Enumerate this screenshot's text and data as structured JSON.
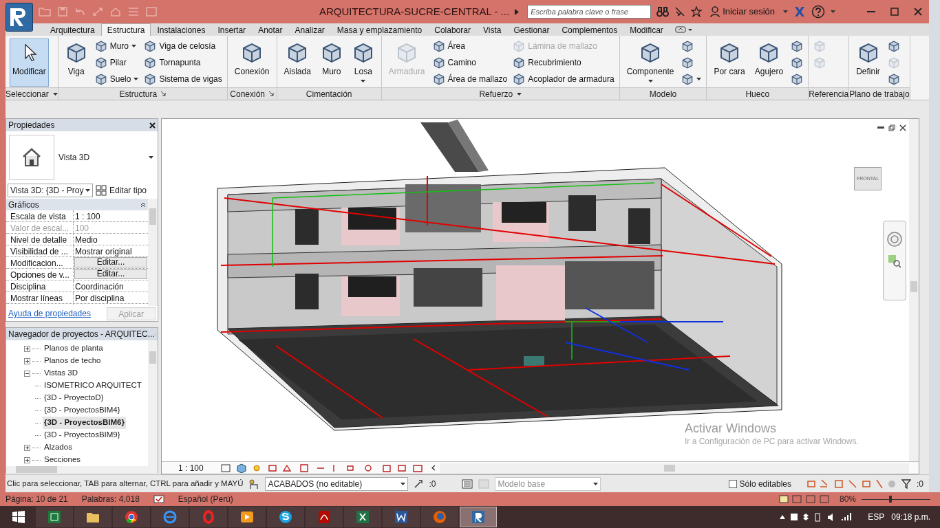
{
  "title_bar": {
    "title": "ARQUITECTURA-SUCRE-CENTRAL - ...",
    "search_placeholder": "Escriba palabra clave o frase",
    "sign_in": "Iniciar sesión"
  },
  "ribbon_tabs": [
    {
      "label": "Arquitectura",
      "selected": false
    },
    {
      "label": "Estructura",
      "selected": true
    },
    {
      "label": "Instalaciones",
      "selected": false
    },
    {
      "label": "Insertar",
      "selected": false
    },
    {
      "label": "Anotar",
      "selected": false
    },
    {
      "label": "Analizar",
      "selected": false
    },
    {
      "label": "Masa y emplazamiento",
      "selected": false
    },
    {
      "label": "Colaborar",
      "selected": false
    },
    {
      "label": "Vista",
      "selected": false
    },
    {
      "label": "Gestionar",
      "selected": false
    },
    {
      "label": "Complementos",
      "selected": false
    },
    {
      "label": "Modificar",
      "selected": false
    }
  ],
  "ribbon_panels": [
    {
      "title": "Seleccionar",
      "has_dropdown": true,
      "has_launcher": false,
      "groups": [
        {
          "kind": "large",
          "label": "Modificar",
          "selected": true,
          "disabled": false,
          "has_menu": false
        }
      ]
    },
    {
      "title": "Estructura",
      "has_dropdown": false,
      "has_launcher": true,
      "groups": [
        {
          "kind": "large",
          "label": "Viga",
          "selected": false,
          "disabled": false,
          "has_menu": false
        },
        {
          "kind": "stack",
          "items": [
            {
              "label": "Muro",
              "disabled": false,
              "has_menu": true
            },
            {
              "label": "Pilar",
              "disabled": false,
              "has_menu": false
            },
            {
              "label": "Suelo",
              "disabled": false,
              "has_menu": true
            }
          ]
        },
        {
          "kind": "stack",
          "items": [
            {
              "label": "Viga de celosía",
              "disabled": false,
              "has_menu": false
            },
            {
              "label": "Tornapunta",
              "disabled": false,
              "has_menu": false
            },
            {
              "label": "Sistema de vigas",
              "disabled": false,
              "has_menu": false
            }
          ]
        }
      ]
    },
    {
      "title": "Conexión",
      "has_dropdown": false,
      "has_launcher": true,
      "groups": [
        {
          "kind": "large",
          "label": "Conexión",
          "selected": false,
          "disabled": false,
          "has_menu": false
        }
      ]
    },
    {
      "title": "Cimentación",
      "has_dropdown": false,
      "has_launcher": false,
      "groups": [
        {
          "kind": "large",
          "label": "Aislada",
          "selected": false,
          "disabled": false,
          "has_menu": false
        },
        {
          "kind": "large",
          "label": "Muro",
          "selected": false,
          "disabled": false,
          "has_menu": false
        },
        {
          "kind": "large",
          "label": "Losa",
          "selected": false,
          "disabled": false,
          "has_menu": true
        }
      ]
    },
    {
      "title": "Refuerzo",
      "has_dropdown": true,
      "has_launcher": false,
      "groups": [
        {
          "kind": "large",
          "label": "Armadura",
          "selected": false,
          "disabled": true,
          "has_menu": false
        },
        {
          "kind": "stack",
          "items": [
            {
              "label": "Área",
              "disabled": false,
              "has_menu": false
            },
            {
              "label": "Camino",
              "disabled": false,
              "has_menu": false
            },
            {
              "label": "Área de mallazo",
              "disabled": false,
              "has_menu": false
            }
          ]
        },
        {
          "kind": "stack",
          "items": [
            {
              "label": "Lámina de mallazo",
              "disabled": true,
              "has_menu": false
            },
            {
              "label": "Recubrimiento",
              "disabled": false,
              "has_menu": false
            },
            {
              "label": "Acoplador de armadura",
              "disabled": false,
              "has_menu": false
            }
          ]
        }
      ]
    },
    {
      "title": "Modelo",
      "has_dropdown": false,
      "has_launcher": false,
      "groups": [
        {
          "kind": "large",
          "label": "Componente",
          "selected": false,
          "disabled": false,
          "has_menu": true
        },
        {
          "kind": "stack",
          "items": [
            {
              "disabled": false,
              "has_menu": false
            },
            {
              "disabled": false,
              "has_menu": false
            },
            {
              "disabled": false,
              "has_menu": true
            }
          ]
        }
      ]
    },
    {
      "title": "Hueco",
      "has_dropdown": false,
      "has_launcher": false,
      "groups": [
        {
          "kind": "large",
          "label": "Por cara",
          "selected": false,
          "disabled": false,
          "has_menu": false
        },
        {
          "kind": "large",
          "label": "Agujero",
          "selected": false,
          "disabled": false,
          "has_menu": false
        },
        {
          "kind": "stack",
          "items": [
            {
              "disabled": false,
              "has_menu": false
            },
            {
              "disabled": false,
              "has_menu": false
            },
            {
              "disabled": false,
              "has_menu": false
            }
          ]
        }
      ]
    },
    {
      "title": "Referencia",
      "has_dropdown": false,
      "has_launcher": false,
      "groups": [
        {
          "kind": "stack",
          "items": [
            {
              "disabled": true,
              "has_menu": false
            },
            {
              "disabled": true,
              "has_menu": false
            }
          ]
        }
      ]
    },
    {
      "title": "Plano de trabajo",
      "has_dropdown": false,
      "has_launcher": false,
      "groups": [
        {
          "kind": "large",
          "label": "Definir",
          "selected": false,
          "disabled": false,
          "has_menu": false
        },
        {
          "kind": "stack",
          "items": [
            {
              "disabled": false,
              "has_menu": false
            },
            {
              "disabled": true,
              "has_menu": false
            },
            {
              "disabled": false,
              "has_menu": false
            }
          ]
        }
      ]
    }
  ],
  "properties": {
    "title": "Propiedades",
    "type_name": "Vista 3D",
    "selector": "Vista 3D: {3D - Proy",
    "edit_type": "Editar tipo",
    "section": "Gráficos",
    "rows": [
      {
        "name": "Escala de vista",
        "value": "1 : 100",
        "kind": "text",
        "disabled": false
      },
      {
        "name": "Valor de escal...",
        "value": "100",
        "kind": "text",
        "disabled": true
      },
      {
        "name": "Nivel de detalle",
        "value": "Medio",
        "kind": "text",
        "disabled": false
      },
      {
        "name": "Visibilidad de ...",
        "value": "Mostrar original",
        "kind": "text",
        "disabled": false
      },
      {
        "name": "Modificacion...",
        "value": "Editar...",
        "kind": "button",
        "disabled": false
      },
      {
        "name": "Opciones de v...",
        "value": "Editar...",
        "kind": "button",
        "disabled": false
      },
      {
        "name": "Disciplina",
        "value": "Coordinación",
        "kind": "text",
        "disabled": false
      },
      {
        "name": "Mostrar líneas",
        "value": "Por disciplina",
        "kind": "text",
        "disabled": false
      }
    ],
    "help_link": "Ayuda de propiedades",
    "apply": "Aplicar",
    "apply_disabled": true
  },
  "project_browser": {
    "title": "Navegador de proyectos - ARQUITEC...",
    "tree": [
      {
        "label": "Planos de planta",
        "expanded": false,
        "selected": false
      },
      {
        "label": "Planos de techo",
        "expanded": false,
        "selected": false
      },
      {
        "label": "Vistas 3D",
        "expanded": true,
        "selected": false,
        "children": [
          {
            "label": "ISOMETRICO ARQUITECT",
            "selected": false
          },
          {
            "label": "{3D - ProyectoD}",
            "selected": false
          },
          {
            "label": "{3D - ProyectosBIM4}",
            "selected": false
          },
          {
            "label": "{3D - ProyectosBIM6}",
            "selected": true
          },
          {
            "label": "{3D - ProyectosBIM9}",
            "selected": false
          }
        ]
      },
      {
        "label": "Alzados",
        "expanded": false,
        "selected": false
      },
      {
        "label": "Secciones",
        "expanded": false,
        "selected": false
      }
    ]
  },
  "viewport": {
    "view_cube_label": "FRONTAL",
    "scale": "1 : 100",
    "activation_title": "Activar Windows",
    "activation_text": "Ir a Configuración de PC para activar Windows."
  },
  "status_bar": {
    "hint": "Clic para seleccionar, TAB para alternar, CTRL para añadir y MAYÚ",
    "workset": "ACABADOS (no editable)",
    "workset_count": ":0",
    "design_option": "Modelo base",
    "editable_only": "Sólo editables",
    "editable_only_checked": false,
    "filter_count": ":0"
  },
  "word_status": {
    "page": "Página: 10 de 21",
    "words": "Palabras: 4,018",
    "language": "Español (Perú)",
    "zoom": "80%",
    "zoom_slider": {
      "level": 0.4
    }
  },
  "taskbar": {
    "apps": [
      {
        "kind": "sheet",
        "active": false
      },
      {
        "kind": "folder",
        "active": false
      },
      {
        "kind": "chrome",
        "active": false
      },
      {
        "kind": "ie",
        "active": false
      },
      {
        "kind": "ring",
        "active": false
      },
      {
        "kind": "play",
        "active": false
      },
      {
        "kind": "chat",
        "active": false
      },
      {
        "kind": "pdf",
        "active": false
      },
      {
        "kind": "excel",
        "active": false
      },
      {
        "kind": "word",
        "active": false
      },
      {
        "kind": "fox",
        "active": false
      },
      {
        "kind": "revit",
        "active": true
      }
    ],
    "language": "ESP",
    "time": "09:18 p.m."
  }
}
